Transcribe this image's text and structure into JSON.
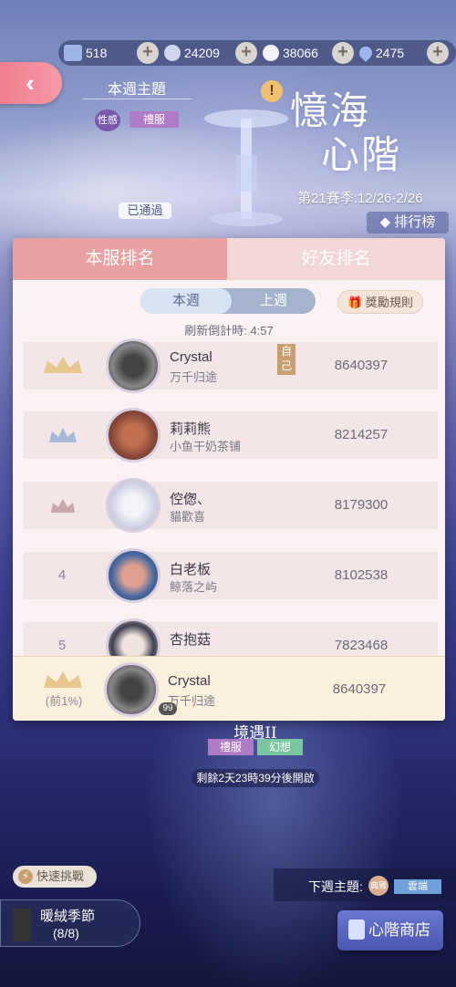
{
  "currency": [
    {
      "name": "puzzle",
      "value": "518",
      "color": "#9fb4e6"
    },
    {
      "name": "diamond",
      "value": "24209",
      "color": "#cfd6ee"
    },
    {
      "name": "star",
      "value": "38066",
      "color": "#f4f0f8"
    },
    {
      "name": "drop",
      "value": "2475",
      "color": "#9bb8f0"
    }
  ],
  "header": {
    "theme_title": "本週主題",
    "tag_xing": "性感",
    "tag_lifu": "禮服",
    "logo_line1": "憶海",
    "logo_line2": "心階",
    "season": "第21賽季:12/26-2/26",
    "ranking_btn": "排行榜",
    "passed": "已通過"
  },
  "panel": {
    "tab_server": "本服排名",
    "tab_friends": "好友排名",
    "week_this": "本週",
    "week_last": "上週",
    "reward_rules": "獎勵規則",
    "refresh": "刷新倒計時: 4:57",
    "rows": [
      {
        "rank": "",
        "name": "Crystal",
        "guild": "万千归途",
        "score": "8640397",
        "self": "自己"
      },
      {
        "rank": "",
        "name": "莉莉熊",
        "guild": "小鱼干奶茶铺",
        "score": "8214257"
      },
      {
        "rank": "",
        "name": "倥偬、",
        "guild": "貓歡喜",
        "score": "8179300"
      },
      {
        "rank": "4",
        "name": "白老板",
        "guild": "鲸落之屿",
        "score": "8102538"
      },
      {
        "rank": "5",
        "name": "杏抱菇",
        "guild": "",
        "score": "7823468"
      }
    ],
    "my": {
      "pct": "(前1%)",
      "name": "Crystal",
      "guild": "万千归途",
      "score": "8640397",
      "lv": "99"
    }
  },
  "realm": {
    "name": "境遇II",
    "tag1": "禮服",
    "tag2": "幻想",
    "countdown": "剩餘2天23時39分後開啟"
  },
  "footer": {
    "quick": "快速挑戰",
    "season_name": "暖絨季節",
    "season_count": "(8/8)",
    "next_theme": "下週主題:",
    "next_tag1": "典雅",
    "next_tag2": "雲端",
    "shop": "心階商店"
  }
}
